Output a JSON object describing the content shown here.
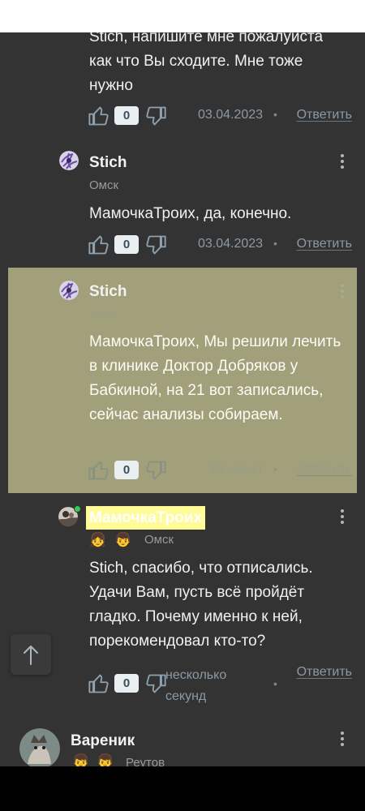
{
  "comments": [
    {
      "text": "Stich, напишите мне пожалуиста как что Вы сходите. Мне тоже нужно",
      "likes": "0",
      "date": "03.04.2023",
      "reply": "Ответить"
    },
    {
      "author": "Stich",
      "city": "Омск",
      "text": "МамочкаТроих, да, конечно.",
      "likes": "0",
      "date": "03.04.2023",
      "reply": "Ответить"
    },
    {
      "author": "Stich",
      "city": "Омск",
      "text": "МамочкаТроих, Мы решили лечить в клинике Доктор Добряков у Бабкиной, на 21 вот записались, сейчас анализы собираем.",
      "likes": "0",
      "date": "19 минут",
      "reply": "Ответить"
    },
    {
      "author": "МамочкаТроих",
      "city": "Омск",
      "badges": [
        "girl-emoji",
        "boy-emoji"
      ],
      "online": true,
      "text": "Stich, спасибо, что отписались. Удачи Вам, пусть всё пройдёт гладко. Почему именно к ней, порекомендовал кто-то?",
      "likes": "0",
      "date": "несколько секунд",
      "reply": "Ответить"
    },
    {
      "author": "Вареник",
      "city": "Реутов",
      "badges": [
        "boy-emoji",
        "boy-emoji"
      ]
    }
  ],
  "colors": {
    "background": "#333333",
    "highlight": "#a1a07a",
    "author_highlight": "#fffb97",
    "link": "#8c99a3",
    "count_badge": "#e9eef1"
  },
  "icons": [
    "like-icon",
    "dislike-icon",
    "more-vert-icon",
    "arrow-up-icon"
  ]
}
